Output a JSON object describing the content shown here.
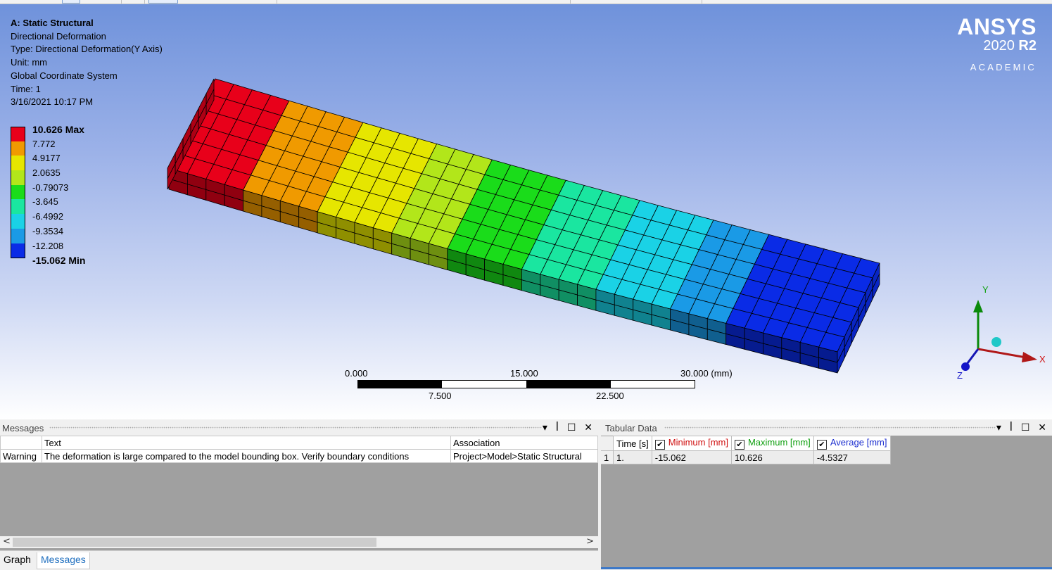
{
  "result_info": {
    "title": "A: Static Structural",
    "lines": [
      "Directional Deformation",
      "Type: Directional Deformation(Y Axis)",
      "Unit: mm",
      "Global Coordinate System",
      "Time: 1",
      "3/16/2021 10:17 PM"
    ]
  },
  "legend": {
    "labels": [
      "10.626 Max",
      "7.772",
      "4.9177",
      "2.0635",
      "-0.79073",
      "-3.645",
      "-6.4992",
      "-9.3534",
      "-12.208",
      "-15.062 Min"
    ],
    "colors": [
      "#e8001a",
      "#f09a00",
      "#e6e600",
      "#b2e61a",
      "#1adc1a",
      "#1ae6a0",
      "#1ad2e6",
      "#1a9ae6",
      "#0a2be6"
    ]
  },
  "brand": {
    "name": "ANSYS",
    "version": "2020",
    "release": "R2",
    "edition": "ACADEMIC"
  },
  "scale_bar": {
    "top_labels": [
      "0.000",
      "15.000",
      "30.000 (mm)"
    ],
    "bottom_labels": [
      "7.500",
      "22.500"
    ]
  },
  "triad": {
    "x": "X",
    "y": "Y",
    "z": "Z"
  },
  "messages": {
    "title": "Messages",
    "controls": "▾ ꟾ ☐ ✕",
    "columns": [
      "",
      "Text",
      "Association"
    ],
    "rows": [
      {
        "type": "Warning",
        "text": "The deformation is large compared to the model bounding box.  Verify boundary conditions",
        "association": "Project>Model>Static Structural"
      }
    ],
    "tabs": [
      "Graph",
      "Messages"
    ],
    "active_tab": "Messages"
  },
  "tabular": {
    "title": "Tabular Data",
    "controls": "▾ ꟾ ☐ ✕",
    "columns": [
      {
        "label": "Time [s]",
        "color": "#000000",
        "check": false
      },
      {
        "label": "Minimum [mm]",
        "color": "#d01010",
        "check": true
      },
      {
        "label": "Maximum [mm]",
        "color": "#10a010",
        "check": true
      },
      {
        "label": "Average [mm]",
        "color": "#1c2ed0",
        "check": true
      }
    ],
    "rows": [
      {
        "index": "1",
        "time": "1.",
        "min": "-15.062",
        "max": "10.626",
        "avg": "-4.5327"
      }
    ]
  }
}
